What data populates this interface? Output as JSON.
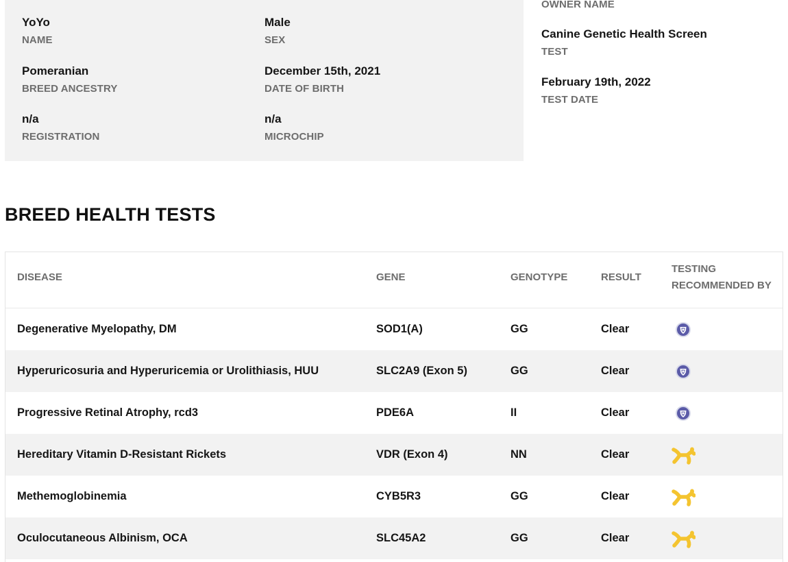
{
  "dog": {
    "name": {
      "value": "YoYo",
      "label": "NAME"
    },
    "sex": {
      "value": "Male",
      "label": "SEX"
    },
    "breed": {
      "value": "Pomeranian",
      "label": "BREED ANCESTRY"
    },
    "dob": {
      "value": "December 15th, 2021",
      "label": "DATE OF BIRTH"
    },
    "registration": {
      "value": "n/a",
      "label": "REGISTRATION"
    },
    "microchip": {
      "value": "n/a",
      "label": "MICROCHIP"
    }
  },
  "owner": {
    "label": "OWNER NAME"
  },
  "test": {
    "value": "Canine Genetic Health Screen",
    "label": "TEST"
  },
  "test_date": {
    "value": "February 19th, 2022",
    "label": "TEST DATE"
  },
  "section_title": "BREED HEALTH TESTS",
  "table": {
    "headers": {
      "disease": "DISEASE",
      "gene": "GENE",
      "genotype": "GENOTYPE",
      "result": "RESULT",
      "recommended_line1": "TESTING",
      "recommended_line2": "RECOMMENDED BY"
    },
    "rows": [
      {
        "disease": "Degenerative Myelopathy, DM",
        "gene": "SOD1(A)",
        "genotype": "GG",
        "result": "Clear",
        "recommended_icon": "shield-badge-icon"
      },
      {
        "disease": "Hyperuricosuria and Hyperuricemia or Urolithiasis, HUU",
        "gene": "SLC2A9 (Exon 5)",
        "genotype": "GG",
        "result": "Clear",
        "recommended_icon": "shield-badge-icon"
      },
      {
        "disease": "Progressive Retinal Atrophy, rcd3",
        "gene": "PDE6A",
        "genotype": "II",
        "result": "Clear",
        "recommended_icon": "shield-badge-icon"
      },
      {
        "disease": "Hereditary Vitamin D-Resistant Rickets",
        "gene": "VDR (Exon 4)",
        "genotype": "NN",
        "result": "Clear",
        "recommended_icon": "balloon-dog-icon"
      },
      {
        "disease": "Methemoglobinemia",
        "gene": "CYB5R3",
        "genotype": "GG",
        "result": "Clear",
        "recommended_icon": "balloon-dog-icon"
      },
      {
        "disease": "Oculocutaneous Albinism, OCA",
        "gene": "SLC45A2",
        "genotype": "GG",
        "result": "Clear",
        "recommended_icon": "balloon-dog-icon"
      }
    ]
  },
  "colors": {
    "card_bg": "#f2f2f2",
    "label_gray": "#6d6d6d",
    "shield_purple": "#5b5ba8",
    "balloon_yellow": "#f4c430"
  }
}
